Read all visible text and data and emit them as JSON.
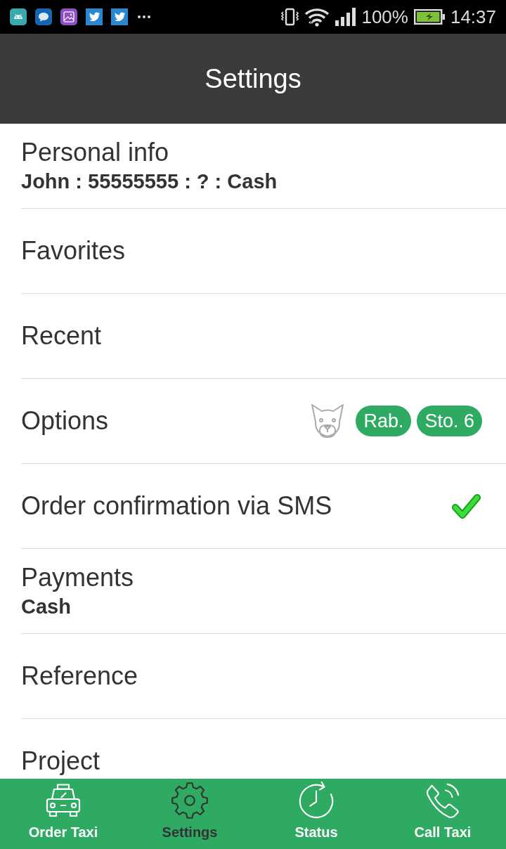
{
  "status_bar": {
    "battery_text": "100%",
    "time": "14:37"
  },
  "app_bar": {
    "title": "Settings"
  },
  "settings": [
    {
      "kind": "text",
      "title": "Personal info",
      "subtitle": "John : 55555555 : ? : Cash"
    },
    {
      "kind": "text",
      "title": "Favorites"
    },
    {
      "kind": "text",
      "title": "Recent"
    },
    {
      "kind": "options",
      "title": "Options",
      "badges": [
        "Rab.",
        "Sto. 6"
      ]
    },
    {
      "kind": "checkbox",
      "title": "Order confirmation via SMS",
      "checked": true
    },
    {
      "kind": "text",
      "title": "Payments",
      "subtitle": "Cash"
    },
    {
      "kind": "text",
      "title": "Reference"
    },
    {
      "kind": "text",
      "title": "Project"
    }
  ],
  "bottom_nav": [
    {
      "label": "Order Taxi",
      "selected": false
    },
    {
      "label": "Settings",
      "selected": true
    },
    {
      "label": "Status",
      "selected": false
    },
    {
      "label": "Call Taxi",
      "selected": false
    }
  ]
}
